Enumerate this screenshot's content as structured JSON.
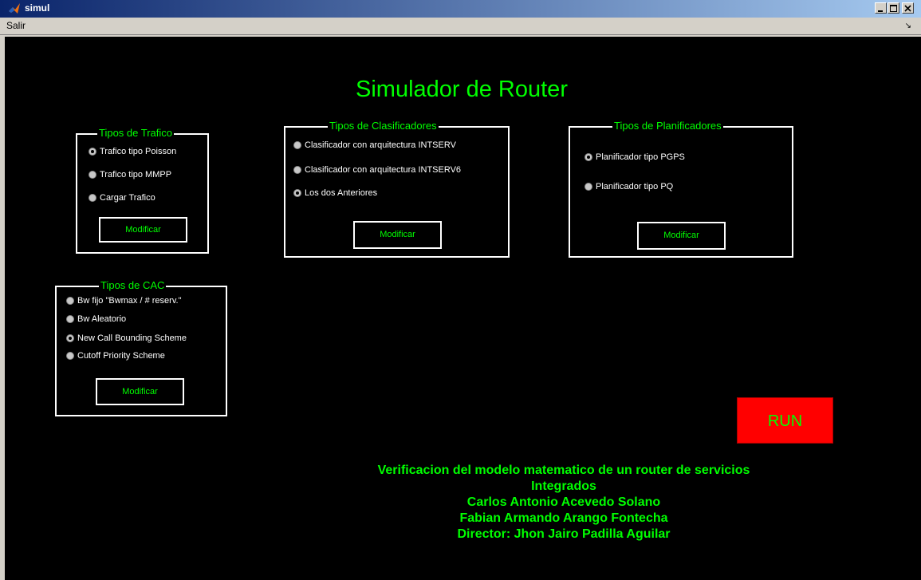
{
  "window": {
    "title": "simul"
  },
  "menu": {
    "items": [
      "Salir"
    ]
  },
  "main_title": "Simulador de Router",
  "trafico": {
    "title": "Tipos de Trafico",
    "options": [
      "Trafico tipo Poisson",
      "Trafico tipo MMPP",
      "Cargar Trafico"
    ],
    "selected": 0,
    "button": "Modificar"
  },
  "clasificadores": {
    "title": "Tipos de Clasificadores",
    "options": [
      "Clasificador con arquitectura INTSERV",
      "Clasificador con arquitectura INTSERV6",
      "Los dos Anteriores"
    ],
    "selected": 2,
    "button": "Modificar"
  },
  "planificadores": {
    "title": "Tipos de Planificadores",
    "options": [
      "Planificador tipo PGPS",
      "Planificador tipo PQ"
    ],
    "selected": 0,
    "button": "Modificar"
  },
  "cac": {
    "title": "Tipos de CAC",
    "options": [
      "Bw fijo \"Bwmax / # reserv.\"",
      "Bw Aleatorio",
      "New Call Bounding Scheme",
      "Cutoff Priority Scheme"
    ],
    "selected": 2,
    "button": "Modificar"
  },
  "run_label": "RUN",
  "credits": [
    "Verificacion del modelo matematico de un router de servicios",
    "Integrados",
    "Carlos Antonio Acevedo Solano",
    "Fabian Armando Arango Fontecha",
    "Director: Jhon Jairo Padilla Aguilar"
  ],
  "colors": {
    "accent": "#00ff00",
    "background": "#000000",
    "run": "#ff0000"
  }
}
